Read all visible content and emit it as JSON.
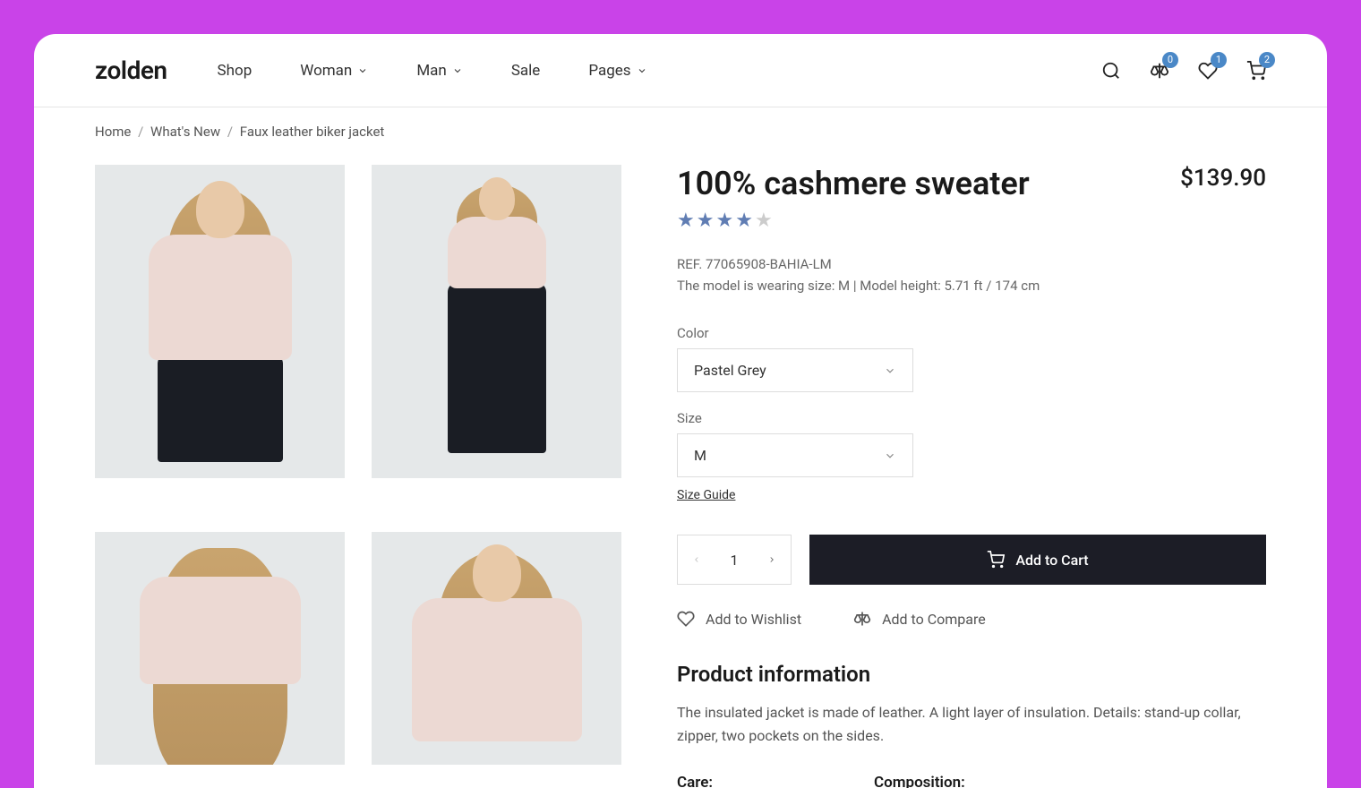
{
  "logo": "zolden",
  "nav": {
    "shop": "Shop",
    "woman": "Woman",
    "man": "Man",
    "sale": "Sale",
    "pages": "Pages"
  },
  "badges": {
    "compare": "0",
    "wishlist": "1",
    "cart": "2"
  },
  "breadcrumb": {
    "home": "Home",
    "whatsnew": "What's New",
    "current": "Faux leather biker jacket"
  },
  "product": {
    "title": "100% cashmere sweater",
    "price": "$139.90",
    "rating": 4,
    "ref": "REF. 77065908-BAHIA-LM",
    "model_info": "The model is wearing size: M | Model height: 5.71 ft / 174 cm",
    "color_label": "Color",
    "color_value": "Pastel Grey",
    "size_label": "Size",
    "size_value": "M",
    "size_guide": "Size Guide",
    "quantity": "1",
    "add_to_cart": "Add to Cart",
    "add_to_wishlist": "Add to Wishlist",
    "add_to_compare": "Add to Compare",
    "info_title": "Product information",
    "description": "The insulated jacket is made of leather. A light layer of insulation. Details: stand-up collar, zipper, two pockets on the sides.",
    "care_label": "Care:",
    "composition_label": "Composition:"
  }
}
